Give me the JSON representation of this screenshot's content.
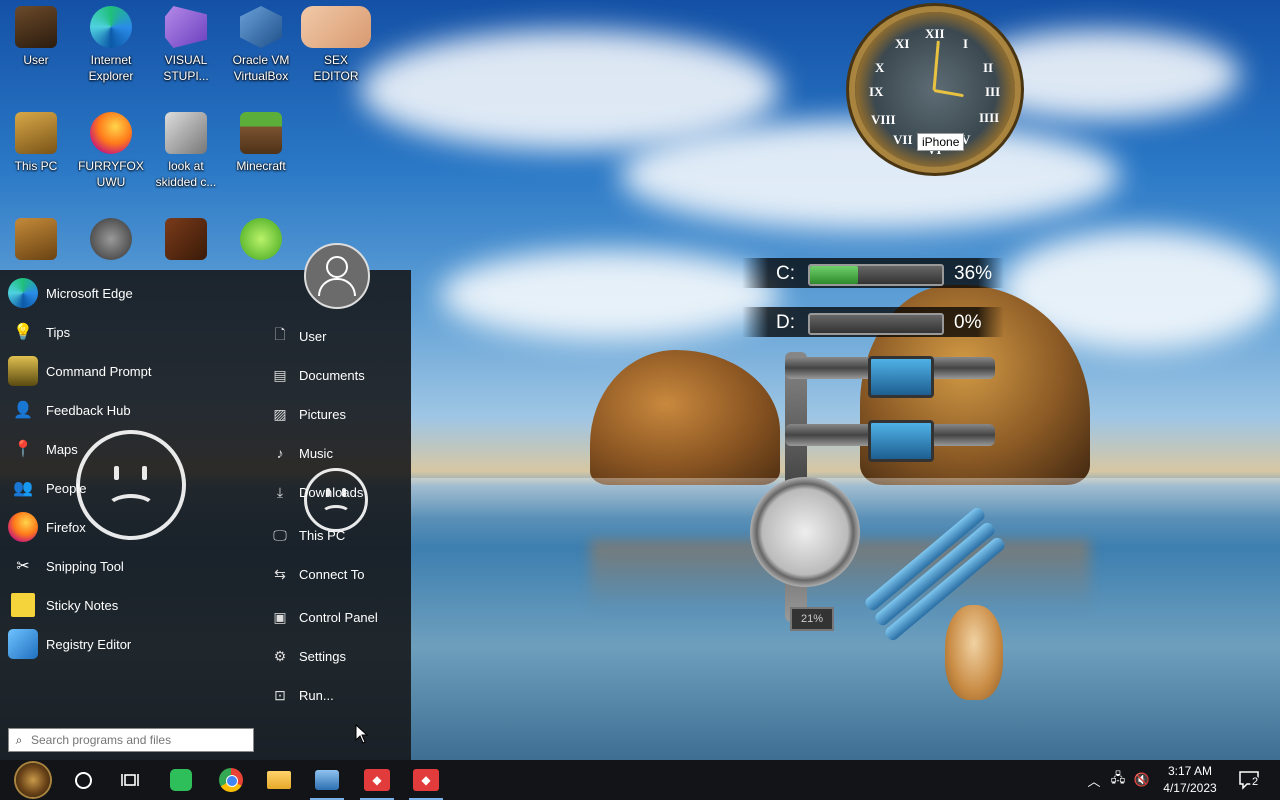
{
  "desktop": {
    "icons": [
      {
        "label": "User"
      },
      {
        "label": "Internet\nExplorer"
      },
      {
        "label": "VISUAL\nSTUPI..."
      },
      {
        "label": "Oracle VM\nVirtualBox"
      },
      {
        "label": "SEX\nEDITOR"
      },
      {
        "label": "This PC"
      },
      {
        "label": "FURRYFOX\nUWU"
      },
      {
        "label": "look at\nskidded c..."
      },
      {
        "label": "Minecraft"
      }
    ]
  },
  "widgets": {
    "clock_tooltip": "iPhone",
    "clock_numerals": [
      "XII",
      "I",
      "II",
      "III",
      "IIII",
      "V",
      "VI",
      "VII",
      "VIII",
      "IX",
      "X",
      "XI"
    ],
    "drives": [
      {
        "letter": "C:",
        "percent_text": "36%",
        "usage": 0.36
      },
      {
        "letter": "D:",
        "percent_text": "0%",
        "usage": 0.0
      }
    ],
    "pipe_gauge_label": "21%"
  },
  "start_menu": {
    "apps": [
      {
        "label": "Microsoft Edge"
      },
      {
        "label": "Tips"
      },
      {
        "label": "Command Prompt"
      },
      {
        "label": "Feedback Hub"
      },
      {
        "label": "Maps"
      },
      {
        "label": "People"
      },
      {
        "label": "Firefox"
      },
      {
        "label": "Snipping Tool"
      },
      {
        "label": "Sticky Notes"
      },
      {
        "label": "Registry Editor"
      }
    ],
    "places": [
      {
        "label": "User"
      },
      {
        "label": "Documents"
      },
      {
        "label": "Pictures"
      },
      {
        "label": "Music"
      },
      {
        "label": "Downloads"
      },
      {
        "label": "This PC"
      },
      {
        "label": "Connect To"
      },
      {
        "label": "Control Panel"
      },
      {
        "label": "Settings"
      },
      {
        "label": "Run..."
      }
    ],
    "search_placeholder": "Search programs and files"
  },
  "taskbar": {
    "time": "3:17 AM",
    "date": "4/17/2023",
    "notification_count": "2"
  },
  "colors": {
    "taskbar_bg": "#121417",
    "start_bg": "#141618",
    "drive_fill": "#3fae3a",
    "accent": "#7ab0e8"
  }
}
